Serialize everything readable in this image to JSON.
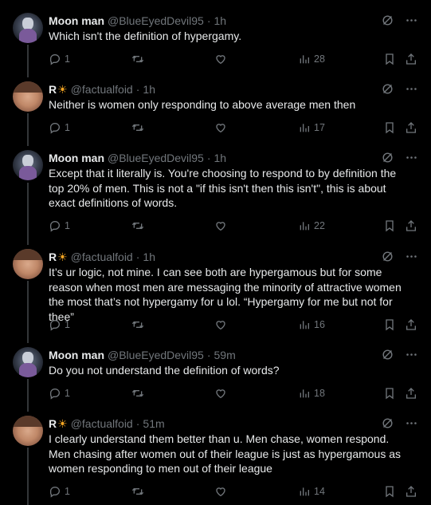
{
  "tweets": [
    {
      "name": "Moon man",
      "handle": "@BlueEyedDevil95",
      "time": "1h",
      "avatar": "moon",
      "text": "Which isn't the definition of hypergamy.",
      "replies": "1",
      "views": "28"
    },
    {
      "name": "R",
      "handle": "@factualfoid",
      "time": "1h",
      "avatar": "r",
      "text": "Neither is women only responding to above average men then",
      "replies": "1",
      "views": "17"
    },
    {
      "name": "Moon man",
      "handle": "@BlueEyedDevil95",
      "time": "1h",
      "avatar": "moon",
      "text": "Except that it literally is. You're choosing to respond to by definition the top 20% of men. This is not a \"if this isn't then this isn't\", this is about exact definitions of words.",
      "replies": "1",
      "views": "22"
    },
    {
      "name": "R",
      "handle": "@factualfoid",
      "time": "1h",
      "avatar": "r",
      "text": "It’s ur logic, not mine. I can see both are hypergamous but for some reason when most men are messaging the minority of attractive women the most that’s not hypergamy for u lol. “Hypergamy for me but not for thee”",
      "replies": "1",
      "views": "16"
    },
    {
      "name": "Moon man",
      "handle": "@BlueEyedDevil95",
      "time": "59m",
      "avatar": "moon",
      "text": "Do you not understand the definition of words?",
      "replies": "1",
      "views": "18"
    },
    {
      "name": "R",
      "handle": "@factualfoid",
      "time": "51m",
      "avatar": "r",
      "text": "I clearly understand them better than u. Men chase, women respond. Men chasing after women out of their league is just as hypergamous as women responding to men out of their league",
      "replies": "1",
      "views": "14"
    }
  ],
  "colors": {
    "background": "#000000",
    "text": "#e7e9ea",
    "muted": "#71767b",
    "thread_line": "#333639",
    "sun_badge": "#f5a623"
  },
  "icons": {
    "reply": "reply-icon",
    "retweet": "retweet-icon",
    "like": "like-icon",
    "views": "views-icon",
    "bookmark": "bookmark-icon",
    "share": "share-icon",
    "grok": "grok-icon",
    "more": "more-icon",
    "badge": "sun-emoji-icon"
  },
  "badge_glyph": "☀"
}
